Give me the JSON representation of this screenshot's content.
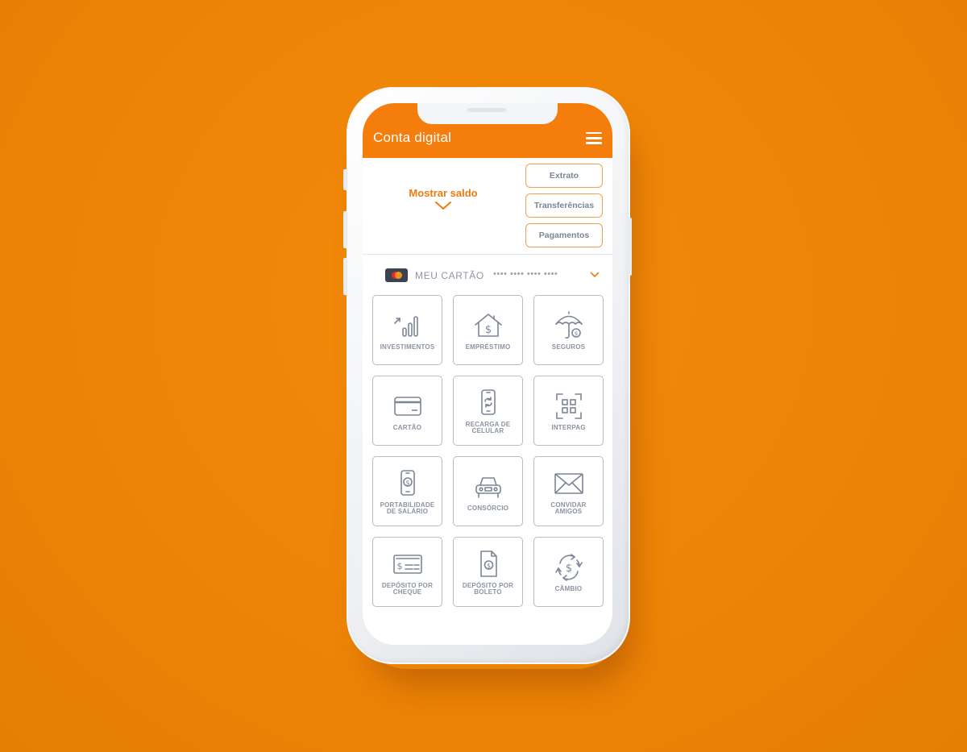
{
  "app": {
    "title": "Conta digital",
    "accent_color": "#f47d0b",
    "menu_icon": "hamburger-menu-icon"
  },
  "balance": {
    "show_label": "Mostrar saldo",
    "toggle_icon": "chevron-down-icon"
  },
  "actions": [
    {
      "label": "Extrato"
    },
    {
      "label": "Transferências"
    },
    {
      "label": "Pagamentos"
    }
  ],
  "card": {
    "label": "MEU CARTÃO",
    "number_masked": "•••• •••• •••• ••••",
    "brand_icon": "mastercard-logo",
    "expand_icon": "chevron-down-icon"
  },
  "services": [
    {
      "label": "INVESTIMENTOS",
      "icon": "investments-chart-icon"
    },
    {
      "label": "EMPRÉSTIMO",
      "icon": "house-dollar-icon"
    },
    {
      "label": "SEGUROS",
      "icon": "umbrella-icon"
    },
    {
      "label": "CARTÃO",
      "icon": "credit-card-icon"
    },
    {
      "label": "RECARGA DE\nCELULAR",
      "icon": "phone-recharge-icon"
    },
    {
      "label": "INTERPAG",
      "icon": "qr-code-icon"
    },
    {
      "label": "PORTABILIDADE\nDE SALÁRIO",
      "icon": "phone-dollar-icon"
    },
    {
      "label": "CONSÓRCIO",
      "icon": "car-icon"
    },
    {
      "label": "CONVIDAR\nAMIGOS",
      "icon": "envelope-icon"
    },
    {
      "label": "DEPÓSITO POR\nCHEQUE",
      "icon": "check-icon"
    },
    {
      "label": "DEPÓSITO POR\nBOLETO",
      "icon": "boleto-document-icon"
    },
    {
      "label": "CÂMBIO",
      "icon": "currency-exchange-icon"
    }
  ]
}
